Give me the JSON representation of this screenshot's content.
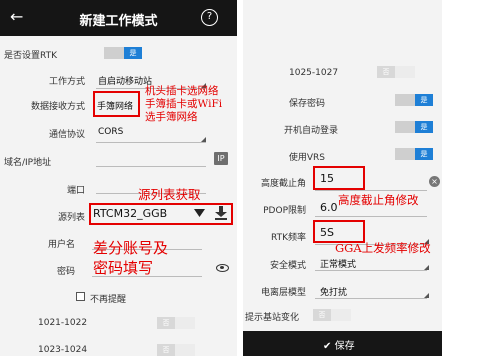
{
  "header": {
    "back_icon": "back-arrow-icon",
    "title": "新建工作模式",
    "help_label": "?"
  },
  "left_form": {
    "rtk_setting_label": "是否设置RTK",
    "rtk_setting_toggle": "是",
    "work_mode_label": "工作方式",
    "work_mode_value": "自启动移动站",
    "data_receive_label": "数据接收方式",
    "data_receive_value": "手簿网络",
    "protocol_label": "通信协议",
    "protocol_value": "CORS",
    "domain_ip_label": "域名/IP地址",
    "ip_button": "IP",
    "port_label": "端口",
    "mountpoint_label": "源列表",
    "mountpoint_value": "RTCM32_GGB",
    "username_label": "用户名",
    "password_label": "密码",
    "no_remind_label": "不再提醒",
    "msg_1021_label": "1021-1022",
    "msg_1021_toggle": "否",
    "msg_1023_label": "1023-1024",
    "msg_1023_toggle": "否"
  },
  "right_form": {
    "msg_1025_label": "1025-1027",
    "msg_1025_toggle": "否",
    "save_password_label": "保存密码",
    "save_password_toggle": "是",
    "auto_login_label": "开机自动登录",
    "auto_login_toggle": "是",
    "use_vrs_label": "使用VRS",
    "use_vrs_toggle": "是",
    "cutoff_angle_label": "高度截止角",
    "cutoff_angle_value": "15",
    "pdop_label": "PDOP限制",
    "pdop_value": "6.0",
    "rtk_freq_label": "RTK频率",
    "rtk_freq_value": "5S",
    "safety_mode_label": "安全模式",
    "safety_mode_value": "正常模式",
    "iono_model_label": "电离层模型",
    "iono_model_value": "免打扰",
    "base_change_label": "提示基站变化",
    "base_change_toggle": "否",
    "save_button": "保存"
  },
  "annotations": {
    "network_line1": "机头插卡选网络",
    "network_line2": "手簿插卡或WiFi",
    "network_line3": "选手簿网络",
    "source_list": "源列表获取",
    "account_line1": "差分账号及",
    "account_line2": "密码填写",
    "cutoff": "高度截止角修改",
    "freq": "GGA上发频率修改"
  },
  "colors": {
    "accent": "#1e7fd6",
    "annotation": "#e40000",
    "header": "#151515"
  }
}
